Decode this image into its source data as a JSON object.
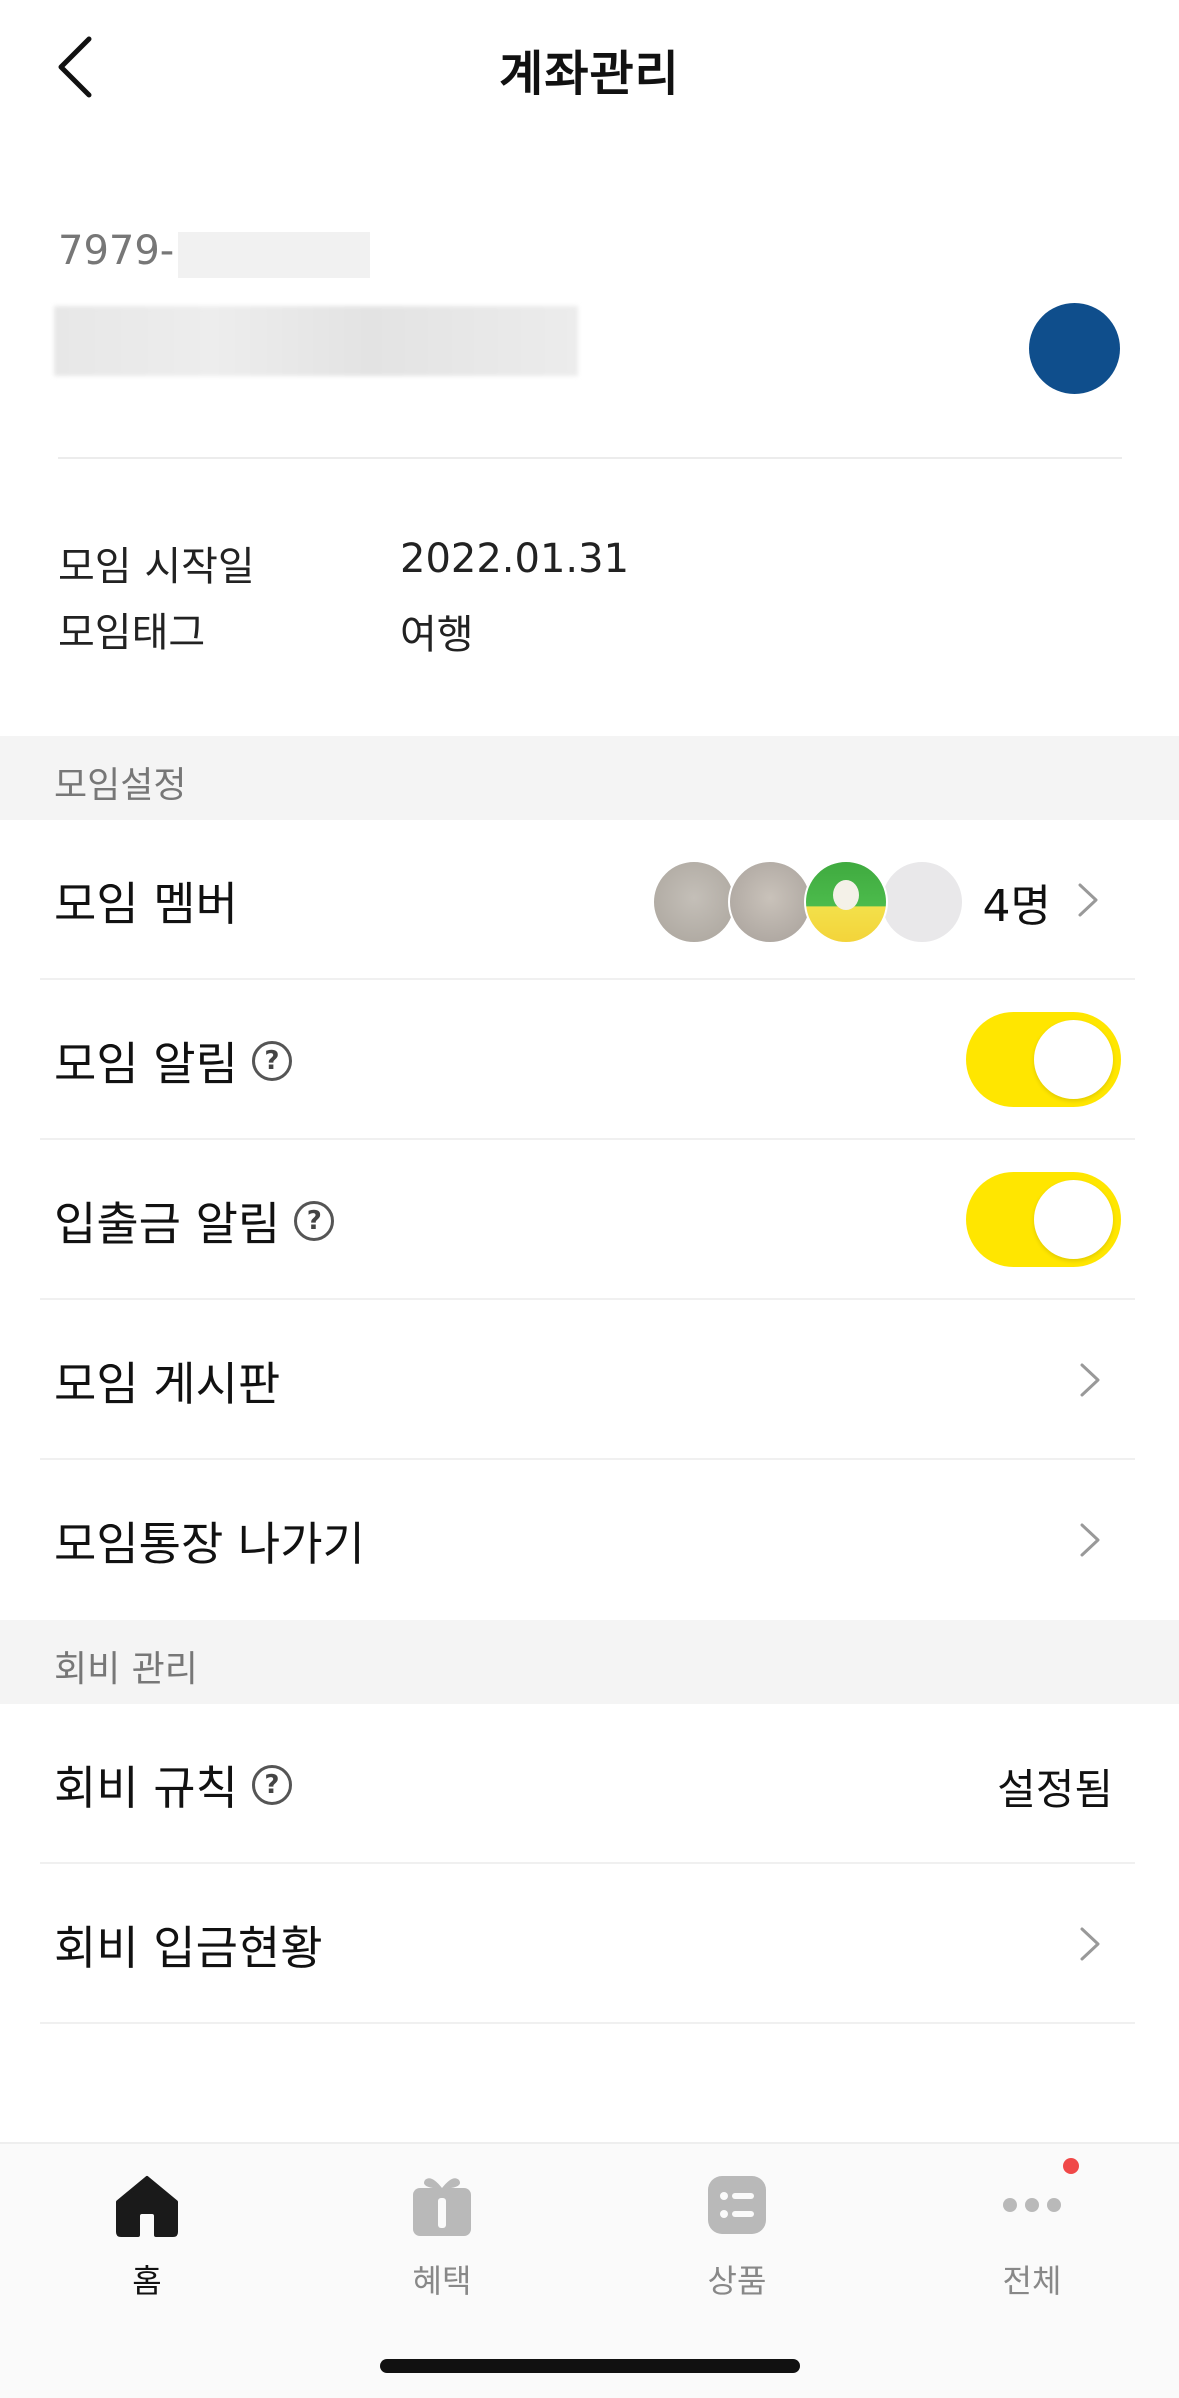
{
  "header": {
    "title": "계좌관리"
  },
  "account": {
    "number_prefix": "7979-",
    "logo_color": "#0f4e8c"
  },
  "info": [
    {
      "label": "모임 시작일",
      "value": "2022.01.31"
    },
    {
      "label": "모임태그",
      "value": "여행"
    }
  ],
  "sections": {
    "group_settings": "모임설정",
    "dues_management": "회비 관리"
  },
  "rows": {
    "members": {
      "label": "모임 멤버",
      "count": "4명"
    },
    "group_alert": {
      "label": "모임 알림",
      "toggle_on": true
    },
    "txn_alert": {
      "label": "입출금 알림",
      "toggle_on": true
    },
    "board": {
      "label": "모임 게시판"
    },
    "leave": {
      "label": "모임통장 나가기"
    },
    "dues_rule": {
      "label": "회비 규칙",
      "value": "설정됨"
    },
    "dues_status": {
      "label": "회비 입금현황"
    }
  },
  "help_icon_glyph": "?",
  "tabs": [
    {
      "label": "홈",
      "icon": "home-icon",
      "active": true
    },
    {
      "label": "혜택",
      "icon": "gift-icon",
      "active": false
    },
    {
      "label": "상품",
      "icon": "list-icon",
      "active": false
    },
    {
      "label": "전체",
      "icon": "more-icon",
      "active": false,
      "badge": true
    }
  ],
  "colors": {
    "accent": "#ffe600",
    "badge": "#f04848"
  }
}
